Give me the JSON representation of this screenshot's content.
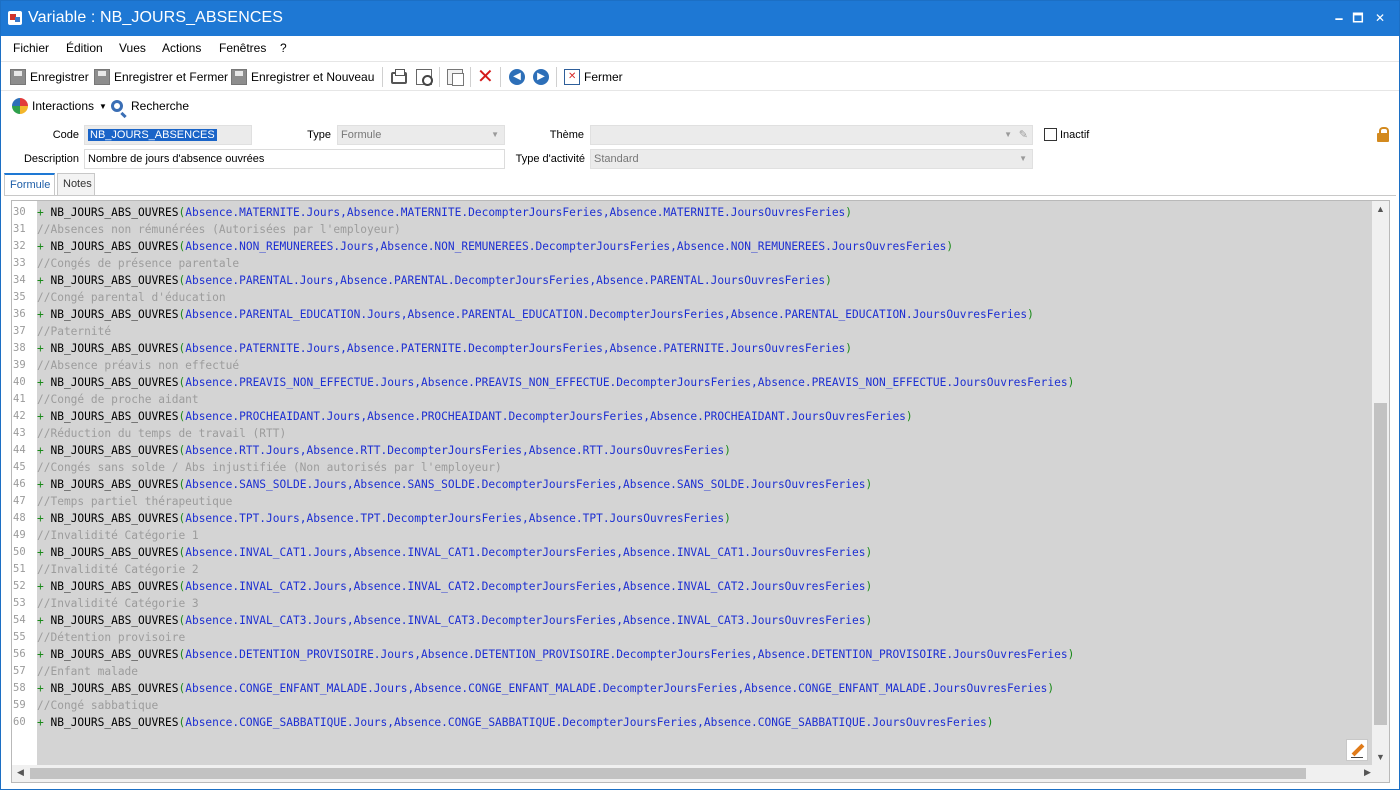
{
  "window": {
    "title": "Variable : NB_JOURS_ABSENCES",
    "controls": {
      "minimize": "🗕",
      "maximize": "🗖",
      "close": "✕"
    }
  },
  "menu": [
    "Fichier",
    "Édition",
    "Vues",
    "Actions",
    "Fenêtres",
    "?"
  ],
  "toolbar": {
    "save": "Enregistrer",
    "save_close": "Enregistrer et Fermer",
    "save_new": "Enregistrer et Nouveau",
    "close": "Fermer"
  },
  "toolbar2": {
    "interactions": "Interactions",
    "search": "Recherche"
  },
  "form": {
    "code_label": "Code",
    "code_value": "NB_JOURS_ABSENCES",
    "type_label": "Type",
    "type_value": "Formule",
    "theme_label": "Thème",
    "theme_value": "",
    "inactive_label": "Inactif",
    "inactive_checked": false,
    "description_label": "Description",
    "description_value": "Nombre de jours d'absence ouvrées",
    "activity_label": "Type d'activité",
    "activity_value": "Standard"
  },
  "tabs": [
    "Formule",
    "Notes"
  ],
  "editor": {
    "lines": [
      {
        "n": "30",
        "kind": "code",
        "fn": "NB_JOURS_ABS_OUVRES",
        "args": "Absence.MATERNITE.Jours,Absence.MATERNITE.DecompterJoursFeries,Absence.MATERNITE.JoursOuvresFeries"
      },
      {
        "n": "31",
        "kind": "comment",
        "text": "//Absences non rémunérées (Autorisées par l'employeur)"
      },
      {
        "n": "32",
        "kind": "code",
        "fn": "NB_JOURS_ABS_OUVRES",
        "args": "Absence.NON_REMUNEREES.Jours,Absence.NON_REMUNEREES.DecompterJoursFeries,Absence.NON_REMUNEREES.JoursOuvresFeries"
      },
      {
        "n": "33",
        "kind": "comment",
        "text": "//Congés de présence parentale"
      },
      {
        "n": "34",
        "kind": "code",
        "fn": "NB_JOURS_ABS_OUVRES",
        "args": "Absence.PARENTAL.Jours,Absence.PARENTAL.DecompterJoursFeries,Absence.PARENTAL.JoursOuvresFeries"
      },
      {
        "n": "35",
        "kind": "comment",
        "text": "//Congé parental d'éducation"
      },
      {
        "n": "36",
        "kind": "code",
        "fn": "NB_JOURS_ABS_OUVRES",
        "args": "Absence.PARENTAL_EDUCATION.Jours,Absence.PARENTAL_EDUCATION.DecompterJoursFeries,Absence.PARENTAL_EDUCATION.JoursOuvresFeries"
      },
      {
        "n": "37",
        "kind": "comment",
        "text": "//Paternité"
      },
      {
        "n": "38",
        "kind": "code",
        "fn": "NB_JOURS_ABS_OUVRES",
        "args": "Absence.PATERNITE.Jours,Absence.PATERNITE.DecompterJoursFeries,Absence.PATERNITE.JoursOuvresFeries"
      },
      {
        "n": "39",
        "kind": "comment",
        "text": "//Absence préavis non effectué"
      },
      {
        "n": "40",
        "kind": "code",
        "fn": "NB_JOURS_ABS_OUVRES",
        "args": "Absence.PREAVIS_NON_EFFECTUE.Jours,Absence.PREAVIS_NON_EFFECTUE.DecompterJoursFeries,Absence.PREAVIS_NON_EFFECTUE.JoursOuvresFeries"
      },
      {
        "n": "41",
        "kind": "comment",
        "text": "//Congé de proche aidant"
      },
      {
        "n": "42",
        "kind": "code",
        "fn": "NB_JOURS_ABS_OUVRES",
        "args": "Absence.PROCHEAIDANT.Jours,Absence.PROCHEAIDANT.DecompterJoursFeries,Absence.PROCHEAIDANT.JoursOuvresFeries"
      },
      {
        "n": "43",
        "kind": "comment",
        "text": "//Réduction du temps de travail (RTT)"
      },
      {
        "n": "44",
        "kind": "code",
        "fn": "NB_JOURS_ABS_OUVRES",
        "args": "Absence.RTT.Jours,Absence.RTT.DecompterJoursFeries,Absence.RTT.JoursOuvresFeries"
      },
      {
        "n": "45",
        "kind": "comment",
        "text": "//Congés sans solde / Abs injustifiée (Non autorisés par l'employeur)"
      },
      {
        "n": "46",
        "kind": "code",
        "fn": "NB_JOURS_ABS_OUVRES",
        "args": "Absence.SANS_SOLDE.Jours,Absence.SANS_SOLDE.DecompterJoursFeries,Absence.SANS_SOLDE.JoursOuvresFeries"
      },
      {
        "n": "47",
        "kind": "comment",
        "text": "//Temps partiel thérapeutique"
      },
      {
        "n": "48",
        "kind": "code",
        "fn": "NB_JOURS_ABS_OUVRES",
        "args": "Absence.TPT.Jours,Absence.TPT.DecompterJoursFeries,Absence.TPT.JoursOuvresFeries"
      },
      {
        "n": "49",
        "kind": "comment",
        "text": "//Invalidité Catégorie 1"
      },
      {
        "n": "50",
        "kind": "code",
        "fn": "NB_JOURS_ABS_OUVRES",
        "args": "Absence.INVAL_CAT1.Jours,Absence.INVAL_CAT1.DecompterJoursFeries,Absence.INVAL_CAT1.JoursOuvresFeries"
      },
      {
        "n": "51",
        "kind": "comment",
        "text": "//Invalidité Catégorie 2"
      },
      {
        "n": "52",
        "kind": "code",
        "fn": "NB_JOURS_ABS_OUVRES",
        "args": "Absence.INVAL_CAT2.Jours,Absence.INVAL_CAT2.DecompterJoursFeries,Absence.INVAL_CAT2.JoursOuvresFeries"
      },
      {
        "n": "53",
        "kind": "comment",
        "text": "//Invalidité Catégorie 3"
      },
      {
        "n": "54",
        "kind": "code",
        "fn": "NB_JOURS_ABS_OUVRES",
        "args": "Absence.INVAL_CAT3.Jours,Absence.INVAL_CAT3.DecompterJoursFeries,Absence.INVAL_CAT3.JoursOuvresFeries"
      },
      {
        "n": "55",
        "kind": "comment",
        "text": "//Détention provisoire"
      },
      {
        "n": "56",
        "kind": "code",
        "fn": "NB_JOURS_ABS_OUVRES",
        "args": "Absence.DETENTION_PROVISOIRE.Jours,Absence.DETENTION_PROVISOIRE.DecompterJoursFeries,Absence.DETENTION_PROVISOIRE.JoursOuvresFeries"
      },
      {
        "n": "57",
        "kind": "comment",
        "text": "//Enfant malade"
      },
      {
        "n": "58",
        "kind": "code",
        "fn": "NB_JOURS_ABS_OUVRES",
        "args": "Absence.CONGE_ENFANT_MALADE.Jours,Absence.CONGE_ENFANT_MALADE.DecompterJoursFeries,Absence.CONGE_ENFANT_MALADE.JoursOuvresFeries"
      },
      {
        "n": "59",
        "kind": "comment",
        "text": "//Congé sabbatique"
      },
      {
        "n": "60",
        "kind": "code",
        "fn": "NB_JOURS_ABS_OUVRES",
        "args": "Absence.CONGE_SABBATIQUE.Jours,Absence.CONGE_SABBATIQUE.DecompterJoursFeries,Absence.CONGE_SABBATIQUE.JoursOuvresFeries"
      }
    ]
  },
  "colors": {
    "titlebar": "#1e78d4",
    "code_background": "#d4d4d4",
    "keyword_plus": "#1a8a1a",
    "argument_text": "#1d2fd2",
    "comment_text": "#9c9c9c",
    "selection": "#1a64c8"
  }
}
